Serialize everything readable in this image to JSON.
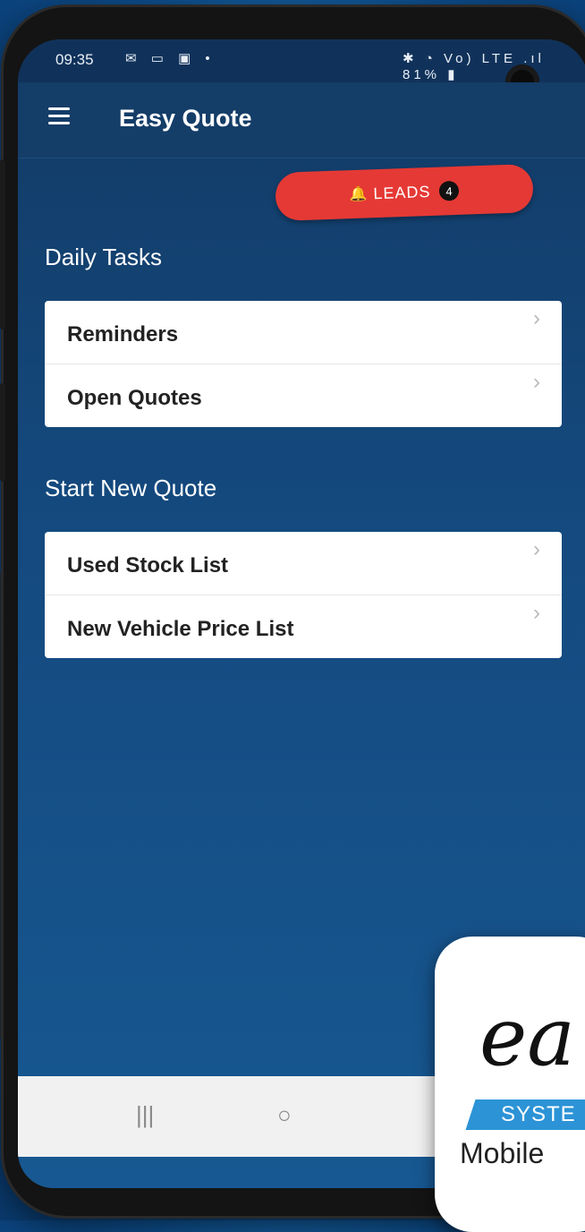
{
  "status_bar": {
    "time": "09:35",
    "left_icons": "✉ ▭ ▣ •",
    "right_icons": "✱ ◔ Vo) LTE .ıl 81% ▮"
  },
  "app_bar": {
    "title": "Easy Quote",
    "menu_icon": "hamburger-menu-icon"
  },
  "leads_button": {
    "label": "LEADS",
    "count": "4",
    "color": "#e53935"
  },
  "daily_tasks": {
    "title": "Daily Tasks",
    "items": [
      {
        "label": "Reminders"
      },
      {
        "label": "Open Quotes"
      }
    ]
  },
  "start_new_quote": {
    "title": "Start New Quote",
    "items": [
      {
        "label": "Used Stock List"
      },
      {
        "label": "New Vehicle Price List"
      }
    ]
  },
  "nav_bar": {
    "recent": "|||",
    "home": "○"
  },
  "logo": {
    "script": "ea",
    "band_text": "SYSTE",
    "mobile_text": "Mobile"
  },
  "colors": {
    "accent": "#e53935",
    "screen_bg": "#14497e",
    "appbar_bg": "#143d68"
  }
}
